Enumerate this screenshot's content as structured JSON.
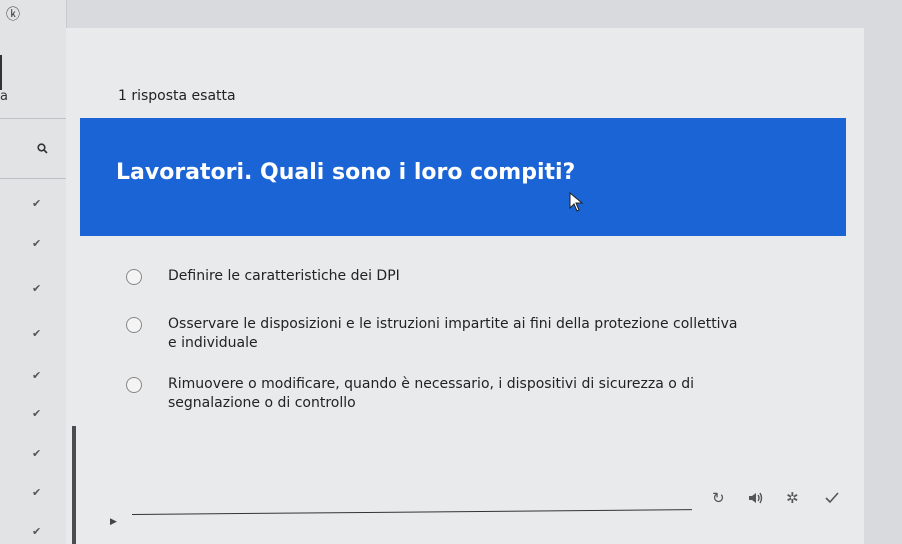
{
  "header": {
    "answer_count": "1 risposta esatta"
  },
  "question": {
    "text": "Lavoratori. Quali sono i loro compiti?"
  },
  "options": [
    {
      "text": "Definire le caratteristiche dei DPI"
    },
    {
      "text": "Osservare le disposizioni e le istruzioni impartite ai fini della protezione collettiva e individuale"
    },
    {
      "text": "Rimuovere o modificare, quando è necessario, i dispositivi di sicurezza o di segnalazione o di controllo"
    }
  ],
  "sidebar": {
    "top_icon": "ⓚ",
    "truncated_text": "a"
  },
  "colors": {
    "banner": "#1a64d6",
    "question_text": "#ffffff"
  },
  "icons": [
    "info-icon",
    "search-icon",
    "check-icon",
    "play-icon",
    "reload-icon",
    "speaker-icon",
    "settings-icon",
    "confirm-check-icon",
    "mouse-cursor-icon"
  ]
}
